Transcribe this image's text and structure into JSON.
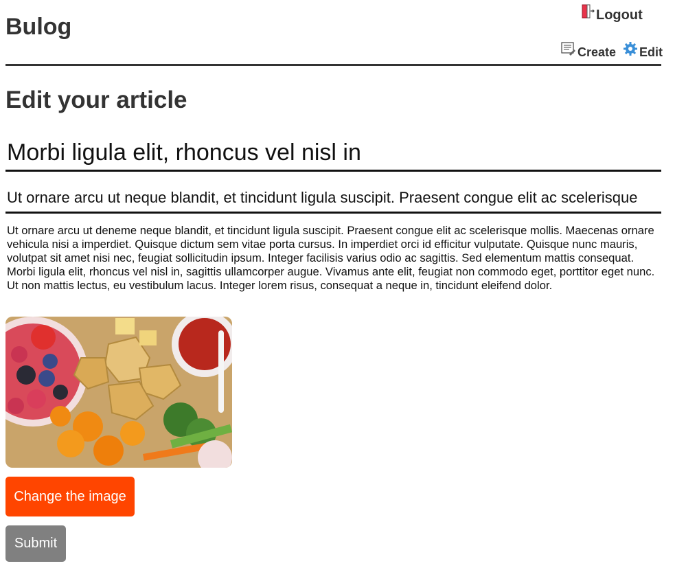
{
  "header": {
    "brand": "Bulog",
    "logout_label": "Logout",
    "create_label": "Create",
    "edit_label": "Edit"
  },
  "page": {
    "heading": "Edit your article"
  },
  "form": {
    "title_value": "Morbi ligula elit, rhoncus vel nisl in",
    "subtitle_value": "Ut ornare arcu ut neque blandit, et tincidunt ligula suscipit. Praesent congue elit ac scelerisque",
    "body_value": "Ut ornare arcu ut deneme neque blandit, et tincidunt ligula suscipit. Praesent congue elit ac scelerisque mollis. Maecenas ornare vehicula nisi a imperdiet. Quisque dictum sem vitae porta cursus. In imperdiet orci id efficitur vulputate. Quisque nunc mauris, volutpat sit amet nisi nec, feugiat sollicitudin ipsum. Integer facilisis varius odio ac sagittis. Sed elementum mattis consequat. Morbi ligula elit, rhoncus vel nisl in, sagittis ullamcorper augue. Vivamus ante elit, feugiat non commodo eget, porttitor eget nunc. Ut non mattis lectus, eu vestibulum lacus. Integer lorem risus, consequat a neque in, tincidunt eleifend dolor.",
    "change_image_label": "Change the image",
    "submit_label": "Submit"
  },
  "icons": {
    "logout": "logout-door-icon",
    "create": "create-document-icon",
    "edit": "gear-icon"
  },
  "colors": {
    "accent": "#ff4500",
    "submit": "#808080",
    "text": "#333333"
  }
}
